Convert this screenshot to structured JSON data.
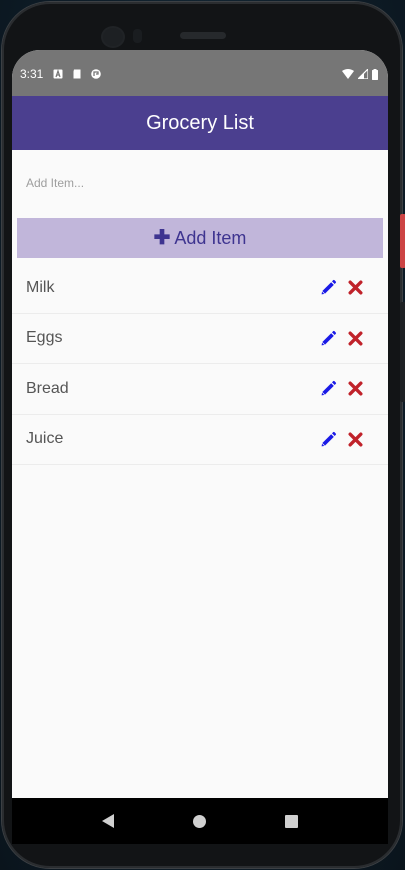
{
  "status_bar": {
    "time": "3:31",
    "left_icons": [
      "a-icon",
      "sd-card-icon",
      "game-icon"
    ],
    "right_icons": [
      "wifi-icon",
      "signal-icon",
      "battery-icon"
    ]
  },
  "app_bar": {
    "title": "Grocery List"
  },
  "add_form": {
    "placeholder": "Add Item...",
    "button_label": "Add Item",
    "button_icon": "plus-icon"
  },
  "items": [
    {
      "label": "Milk"
    },
    {
      "label": "Eggs"
    },
    {
      "label": "Bread"
    },
    {
      "label": "Juice"
    }
  ],
  "colors": {
    "app_bar": "#4b3f8f",
    "add_button_bg": "#c1b6da",
    "add_button_text": "#3e3490",
    "edit_icon": "#1a1ae6",
    "delete_icon": "#c0222a"
  },
  "nav_bar": {
    "buttons": [
      "back-icon",
      "home-icon",
      "recents-icon"
    ]
  }
}
